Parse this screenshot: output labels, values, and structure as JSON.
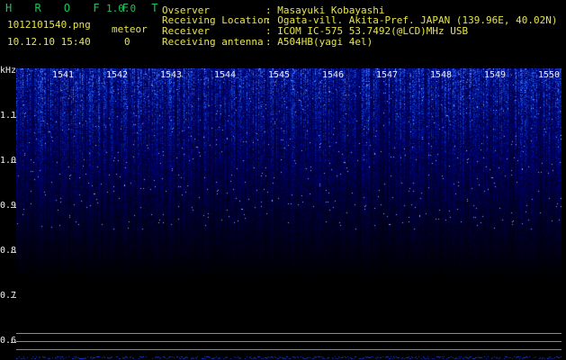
{
  "header": {
    "logo": "H R O F F T",
    "version": "1.0.0",
    "filename": "1012101540.png",
    "datetime": "10.12.10 15:40",
    "meteor_label": "meteor",
    "meteor_count": "0",
    "observer_label": "Ovserver",
    "observer_value": ": Masayuki Kobayashi",
    "location_label": "Receiving Location",
    "location_value": ": Ogata-vill. Akita-Pref. JAPAN (139.96E, 40.02N)",
    "receiver_label": "Receiver",
    "receiver_value": ": ICOM IC-575 53.7492(@LCD)MHz USB",
    "antenna_label": "Receiving antenna",
    "antenna_value": ": A504HB(yagi 4el)"
  },
  "spectrogram": {
    "y_unit": "kHz",
    "y_ticks": [
      "1.1",
      "1.0",
      "0.9",
      "0.8",
      "0.7",
      "0.6"
    ],
    "y_range_khz": [
      0.58,
      1.22
    ],
    "minute_labels": [
      "1541",
      "1542",
      "1543",
      "1544",
      "1545",
      "1546",
      "1547",
      "1548",
      "1549",
      "1550"
    ],
    "colors": {
      "label_text": "#f0f0f0",
      "signal": "#2a4bff",
      "background": "#000000"
    }
  }
}
